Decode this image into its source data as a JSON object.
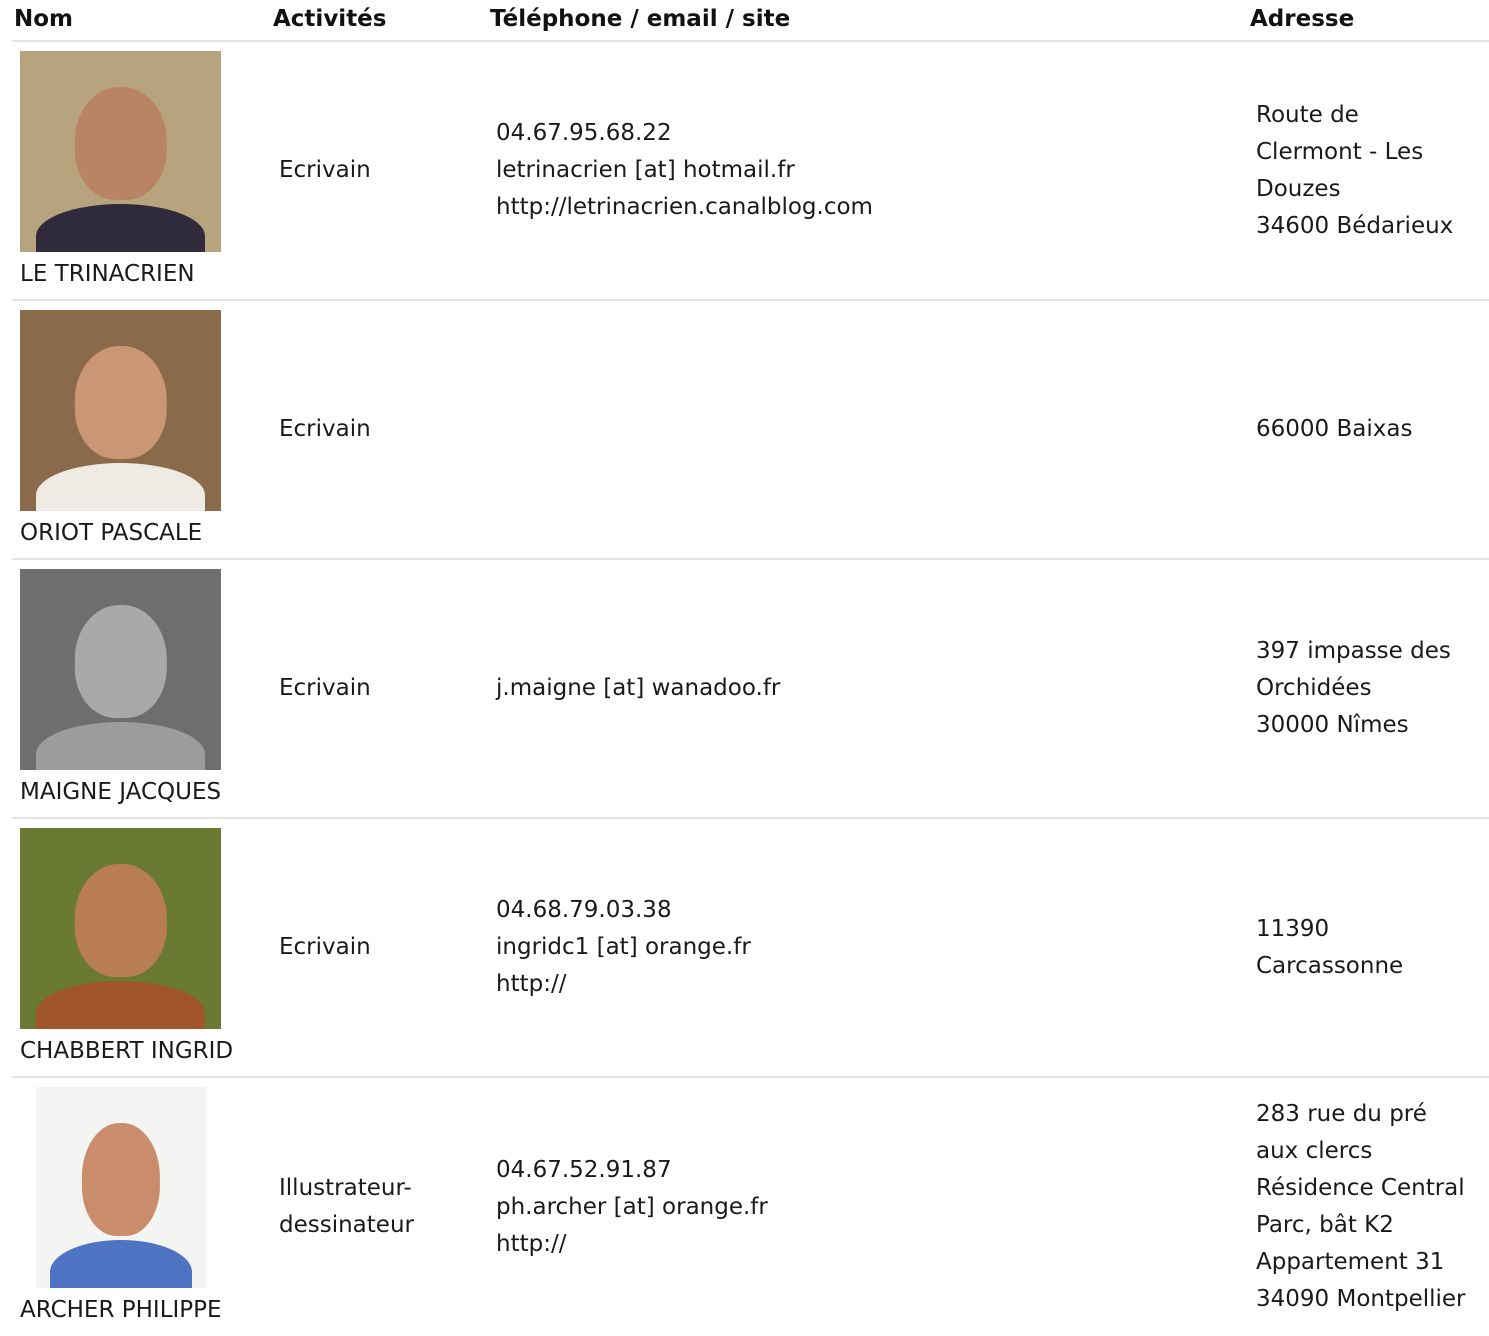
{
  "headers": {
    "name": "Nom",
    "activity": "Activités",
    "contact": "Téléphone / email / site",
    "address": "Adresse"
  },
  "rows": [
    {
      "name": "LE TRINACRIEN",
      "activity": [
        "Ecrivain"
      ],
      "contact": [
        "04.67.95.68.22",
        "letrinacrien [at] hotmail.fr",
        "http://letrinacrien.canalblog.com"
      ],
      "address": [
        "Route de",
        "Clermont - Les",
        "Douzes",
        "34600 Bédarieux"
      ],
      "photo": {
        "bg": "#b7a47e",
        "head": "#b98466",
        "body": "#2f2a3c"
      }
    },
    {
      "name": "ORIOT PASCALE",
      "activity": [
        "Ecrivain"
      ],
      "contact": [],
      "address": [
        "66000 Baixas"
      ],
      "photo": {
        "bg": "#8a6a4a",
        "head": "#c99676",
        "body": "#eeeae4"
      }
    },
    {
      "name": "MAIGNE JACQUES",
      "activity": [
        "Ecrivain"
      ],
      "contact": [
        "j.maigne [at] wanadoo.fr"
      ],
      "address": [
        "397 impasse des",
        "Orchidées",
        "30000 Nîmes"
      ],
      "photo": {
        "bg": "#6e6e6e",
        "head": "#a9a9a9",
        "body": "#9c9c9c"
      }
    },
    {
      "name": "CHABBERT INGRID",
      "activity": [
        "Ecrivain"
      ],
      "contact": [
        "04.68.79.03.38",
        "ingridc1 [at] orange.fr",
        "http://"
      ],
      "address": [
        "11390",
        "Carcassonne"
      ],
      "photo": {
        "bg": "#6b7a33",
        "head": "#b97d54",
        "body": "#a0552c"
      }
    },
    {
      "name": "ARCHER PHILIPPE",
      "activity": [
        "Illustrateur-",
        "dessinateur"
      ],
      "contact": [
        "04.67.52.91.87",
        "ph.archer [at] orange.fr",
        "http://"
      ],
      "address": [
        "283 rue du pré",
        "aux clercs",
        "Résidence Central",
        "Parc, bât K2",
        "Appartement 31",
        "34090 Montpellier"
      ],
      "photo": {
        "bg": "#f4f4f2",
        "head": "#c98d6c",
        "body": "#4f74c4"
      }
    }
  ]
}
